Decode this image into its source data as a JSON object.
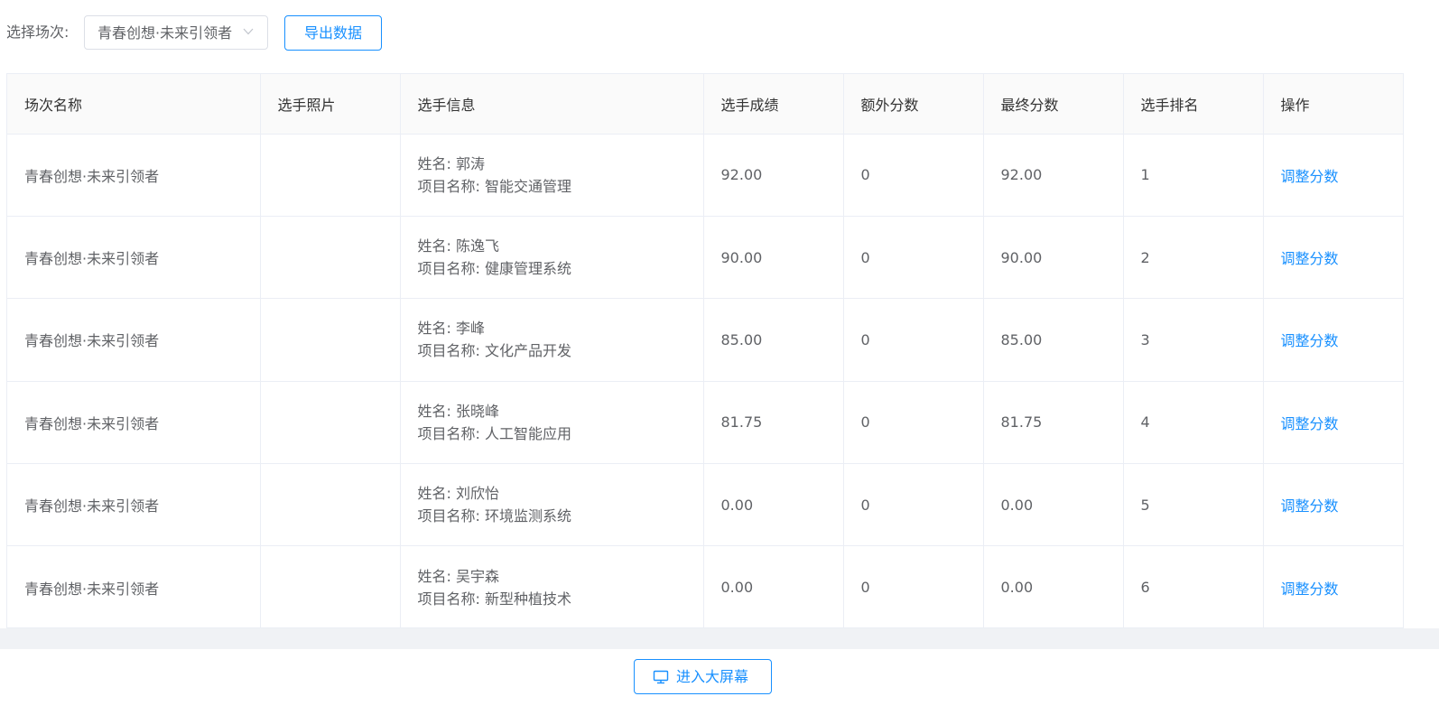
{
  "toolbar": {
    "session_label": "选择场次:",
    "session_select_value": "青春创想·未来引领者",
    "export_button_label": "导出数据"
  },
  "table": {
    "headers": [
      "场次名称",
      "选手照片",
      "选手信息",
      "选手成绩",
      "额外分数",
      "最终分数",
      "选手排名",
      "操作"
    ],
    "rows": [
      {
        "session": "青春创想·未来引领者",
        "photo": "",
        "name_line": "姓名: 郭涛",
        "project_line": "项目名称: 智能交通管理",
        "score": "92.00",
        "extra": "0",
        "final": "92.00",
        "rank": "1",
        "action": "调整分数"
      },
      {
        "session": "青春创想·未来引领者",
        "photo": "",
        "name_line": "姓名: 陈逸飞",
        "project_line": "项目名称: 健康管理系统",
        "score": "90.00",
        "extra": "0",
        "final": "90.00",
        "rank": "2",
        "action": "调整分数"
      },
      {
        "session": "青春创想·未来引领者",
        "photo": "",
        "name_line": "姓名: 李峰",
        "project_line": "项目名称: 文化产品开发",
        "score": "85.00",
        "extra": "0",
        "final": "85.00",
        "rank": "3",
        "action": "调整分数"
      },
      {
        "session": "青春创想·未来引领者",
        "photo": "",
        "name_line": "姓名: 张晓峰",
        "project_line": "项目名称: 人工智能应用",
        "score": "81.75",
        "extra": "0",
        "final": "81.75",
        "rank": "4",
        "action": "调整分数"
      },
      {
        "session": "青春创想·未来引领者",
        "photo": "",
        "name_line": "姓名: 刘欣怡",
        "project_line": "项目名称: 环境监测系统",
        "score": "0.00",
        "extra": "0",
        "final": "0.00",
        "rank": "5",
        "action": "调整分数"
      },
      {
        "session": "青春创想·未来引领者",
        "photo": "",
        "name_line": "姓名: 吴宇森",
        "project_line": "项目名称: 新型种植技术",
        "score": "0.00",
        "extra": "0",
        "final": "0.00",
        "rank": "6",
        "action": "调整分数"
      }
    ]
  },
  "footer": {
    "bigscreen_button_label": "进入大屏幕",
    "bigscreen_icon": "monitor-icon"
  },
  "colors": {
    "accent": "#1890ff",
    "text": "#606266",
    "header_text": "#333333",
    "border": "#ebeef5",
    "header_bg": "#fafafa",
    "scroll_track": "#f0f2f5"
  }
}
